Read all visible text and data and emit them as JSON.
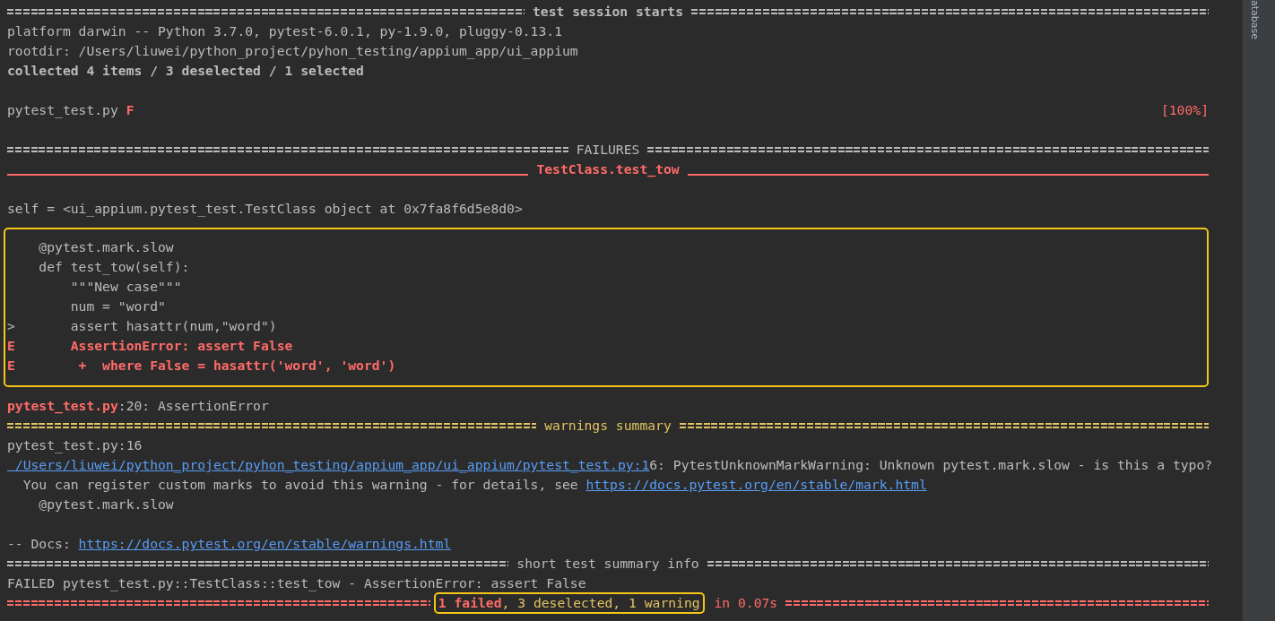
{
  "terminal": {
    "lines": [
      {
        "kind": "rule",
        "color": "#bbbbbb",
        "title": [
          {
            "text": "test session starts",
            "color": "#bbbbbb",
            "bold": true,
            "boxed": false
          }
        ]
      },
      {
        "kind": "text",
        "segments": [
          {
            "kind": "text",
            "text": "platform darwin -- Python 3.7.0, pytest-6.0.1, py-1.9.0, pluggy-0.13.1",
            "color": "#bbbbbb",
            "bold": false
          }
        ]
      },
      {
        "kind": "text",
        "segments": [
          {
            "kind": "text",
            "text": "rootdir: /Users/liuwei/python_project/pyhon_testing/appium_app/ui_appium",
            "color": "#bbbbbb",
            "bold": false
          }
        ]
      },
      {
        "kind": "text",
        "segments": [
          {
            "kind": "text",
            "text": "collected 4 items / 3 deselected / 1 selected",
            "color": "#bbbbbb",
            "bold": true
          }
        ]
      },
      {
        "kind": "blank"
      },
      {
        "kind": "progress",
        "segments": [
          {
            "kind": "text",
            "text": "pytest_test.py ",
            "color": "#bbbbbb",
            "bold": false
          },
          {
            "kind": "text",
            "text": "F",
            "color": "#ff6b68",
            "bold": true
          }
        ],
        "right": "[100%]"
      },
      {
        "kind": "blank"
      },
      {
        "kind": "rule",
        "color": "#bbbbbb",
        "title": [
          {
            "text": "FAILURES",
            "color": "#bbbbbb",
            "bold": false,
            "boxed": false
          }
        ]
      },
      {
        "kind": "underline",
        "color": "#ff6b68",
        "title": [
          {
            "text": "TestClass.test_tow",
            "color": "#ff6b68",
            "bold": true,
            "boxed": false
          }
        ]
      },
      {
        "kind": "blank"
      },
      {
        "kind": "text",
        "segments": [
          {
            "kind": "text",
            "text": "self = <ui_appium.pytest_test.TestClass object at 0x7fa8f6d5e8d0>",
            "color": "#bbbbbb",
            "bold": false
          }
        ]
      },
      {
        "kind": "boxed",
        "lines": [
          {
            "kind": "text",
            "segments": [
              {
                "kind": "text",
                "text": "    @pytest.mark.slow",
                "color": "#bbbbbb",
                "bold": false
              }
            ]
          },
          {
            "kind": "text",
            "segments": [
              {
                "kind": "text",
                "text": "    def test_tow(self):",
                "color": "#bbbbbb",
                "bold": false
              }
            ]
          },
          {
            "kind": "text",
            "segments": [
              {
                "kind": "text",
                "text": "        \"\"\"New case\"\"\"",
                "color": "#bbbbbb",
                "bold": false
              }
            ]
          },
          {
            "kind": "text",
            "segments": [
              {
                "kind": "text",
                "text": "        num = \"word\"",
                "color": "#bbbbbb",
                "bold": false
              }
            ]
          },
          {
            "kind": "text",
            "segments": [
              {
                "kind": "text",
                "text": ">       assert hasattr(num,\"word\")",
                "color": "#bbbbbb",
                "bold": false
              }
            ]
          },
          {
            "kind": "text",
            "segments": [
              {
                "kind": "text",
                "text": "E       AssertionError: assert False",
                "color": "#ff6b68",
                "bold": true
              }
            ]
          },
          {
            "kind": "text",
            "segments": [
              {
                "kind": "text",
                "text": "E        +  where False = hasattr('word', 'word')",
                "color": "#ff6b68",
                "bold": true
              }
            ]
          }
        ]
      },
      {
        "kind": "text",
        "segments": [
          {
            "kind": "text",
            "text": "pytest_test.py",
            "color": "#ff6b68",
            "bold": true
          },
          {
            "kind": "text",
            "text": ":20: AssertionError",
            "color": "#bbbbbb",
            "bold": false
          }
        ]
      },
      {
        "kind": "rule",
        "color": "#e2c35f",
        "title": [
          {
            "text": "warnings summary",
            "color": "#e2c35f",
            "bold": false,
            "boxed": false
          }
        ]
      },
      {
        "kind": "text",
        "segments": [
          {
            "kind": "text",
            "text": "pytest_test.py:16",
            "color": "#bbbbbb",
            "bold": false
          }
        ]
      },
      {
        "kind": "text",
        "segments": [
          {
            "kind": "link",
            "text": " /Users/liuwei/python_project/pyhon_testing/appium_app/ui_appium/pytest_test.py:1",
            "color": "#589df6",
            "bold": false
          },
          {
            "kind": "text",
            "text": "6: PytestUnknownMarkWarning: Unknown pytest.mark.slow - is this a typo?",
            "color": "#bbbbbb",
            "bold": false
          }
        ]
      },
      {
        "kind": "text",
        "segments": [
          {
            "kind": "text",
            "text": "  You can register custom marks to avoid this warning - for details, see ",
            "color": "#bbbbbb",
            "bold": false
          },
          {
            "kind": "link",
            "text": "https://docs.pytest.org/en/stable/mark.html",
            "color": "#589df6",
            "bold": false
          }
        ]
      },
      {
        "kind": "text",
        "segments": [
          {
            "kind": "text",
            "text": "    @pytest.mark.slow",
            "color": "#bbbbbb",
            "bold": false
          }
        ]
      },
      {
        "kind": "blank"
      },
      {
        "kind": "text",
        "segments": [
          {
            "kind": "text",
            "text": "-- Docs: ",
            "color": "#bbbbbb",
            "bold": false
          },
          {
            "kind": "link",
            "text": "https://docs.pytest.org/en/stable/warnings.html",
            "color": "#589df6",
            "bold": false
          }
        ]
      },
      {
        "kind": "rule",
        "color": "#bbbbbb",
        "title": [
          {
            "text": "short test summary info",
            "color": "#bbbbbb",
            "bold": false,
            "boxed": false
          }
        ]
      },
      {
        "kind": "text",
        "segments": [
          {
            "kind": "text",
            "text": "FAILED pytest_test.py::TestClass::test_tow - AssertionError: assert False",
            "color": "#bbbbbb",
            "bold": false
          }
        ]
      },
      {
        "kind": "rule",
        "color": "#ff6b68",
        "title": [
          {
            "text": "1 failed",
            "color": "#ff6b68",
            "bold": true,
            "boxed": true
          },
          {
            "text": ", 3 deselected, 1 warning",
            "color": "#e2c35f",
            "bold": false,
            "boxed": true
          },
          {
            "text": "in 0.07s",
            "color": "#ff6b68",
            "bold": false,
            "boxed": false
          }
        ]
      }
    ]
  },
  "side_tab": {
    "label": "atabase"
  }
}
